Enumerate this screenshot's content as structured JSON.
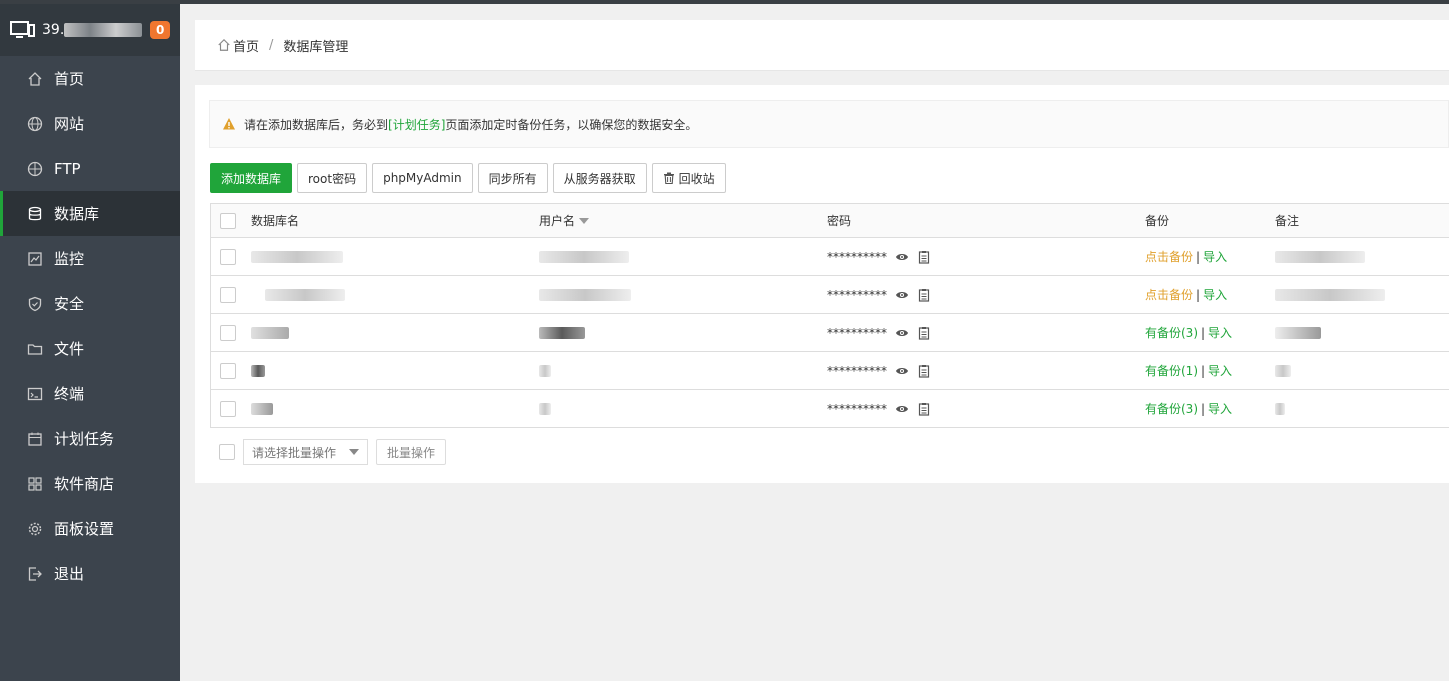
{
  "sidebar": {
    "server_ip": "39.",
    "badge": "0",
    "items": [
      {
        "label": "首页",
        "icon": "home-icon"
      },
      {
        "label": "网站",
        "icon": "globe-icon"
      },
      {
        "label": "FTP",
        "icon": "ftp-icon"
      },
      {
        "label": "数据库",
        "icon": "database-icon",
        "active": true
      },
      {
        "label": "监控",
        "icon": "monitor-icon"
      },
      {
        "label": "安全",
        "icon": "shield-icon"
      },
      {
        "label": "文件",
        "icon": "folder-icon"
      },
      {
        "label": "终端",
        "icon": "terminal-icon"
      },
      {
        "label": "计划任务",
        "icon": "calendar-icon"
      },
      {
        "label": "软件商店",
        "icon": "grid-icon"
      },
      {
        "label": "面板设置",
        "icon": "gear-icon"
      },
      {
        "label": "退出",
        "icon": "logout-icon"
      }
    ]
  },
  "breadcrumb": {
    "home": "首页",
    "sep": "/",
    "current": "数据库管理"
  },
  "notice": {
    "before": "请在添加数据库后，务必到",
    "link": "[计划任务]",
    "after": "页面添加定时备份任务，以确保您的数据安全。"
  },
  "toolbar": {
    "add": "添加数据库",
    "root_pw": "root密码",
    "phpmyadmin": "phpMyAdmin",
    "sync_all": "同步所有",
    "fetch_server": "从服务器获取",
    "recycle": "回收站"
  },
  "table": {
    "headers": {
      "name": "数据库名",
      "user": "用户名",
      "password": "密码",
      "backup": "备份",
      "note": "备注"
    },
    "rows": [
      {
        "password": "**********",
        "backup": "点击备份",
        "backup_status": "none",
        "import": "导入"
      },
      {
        "password": "**********",
        "backup": "点击备份",
        "backup_status": "none",
        "import": "导入"
      },
      {
        "password": "**********",
        "backup": "有备份(3)",
        "backup_status": "has",
        "import": "导入"
      },
      {
        "password": "**********",
        "backup": "有备份(1)",
        "backup_status": "has",
        "import": "导入"
      },
      {
        "password": "**********",
        "backup": "有备份(3)",
        "backup_status": "has",
        "import": "导入"
      }
    ]
  },
  "bulk": {
    "select_placeholder": "请选择批量操作",
    "button": "批量操作"
  },
  "colors": {
    "accent": "#20a53a",
    "sidebar_bg": "#3c444d",
    "warning": "#e0a02c",
    "badge": "#f0762f"
  }
}
